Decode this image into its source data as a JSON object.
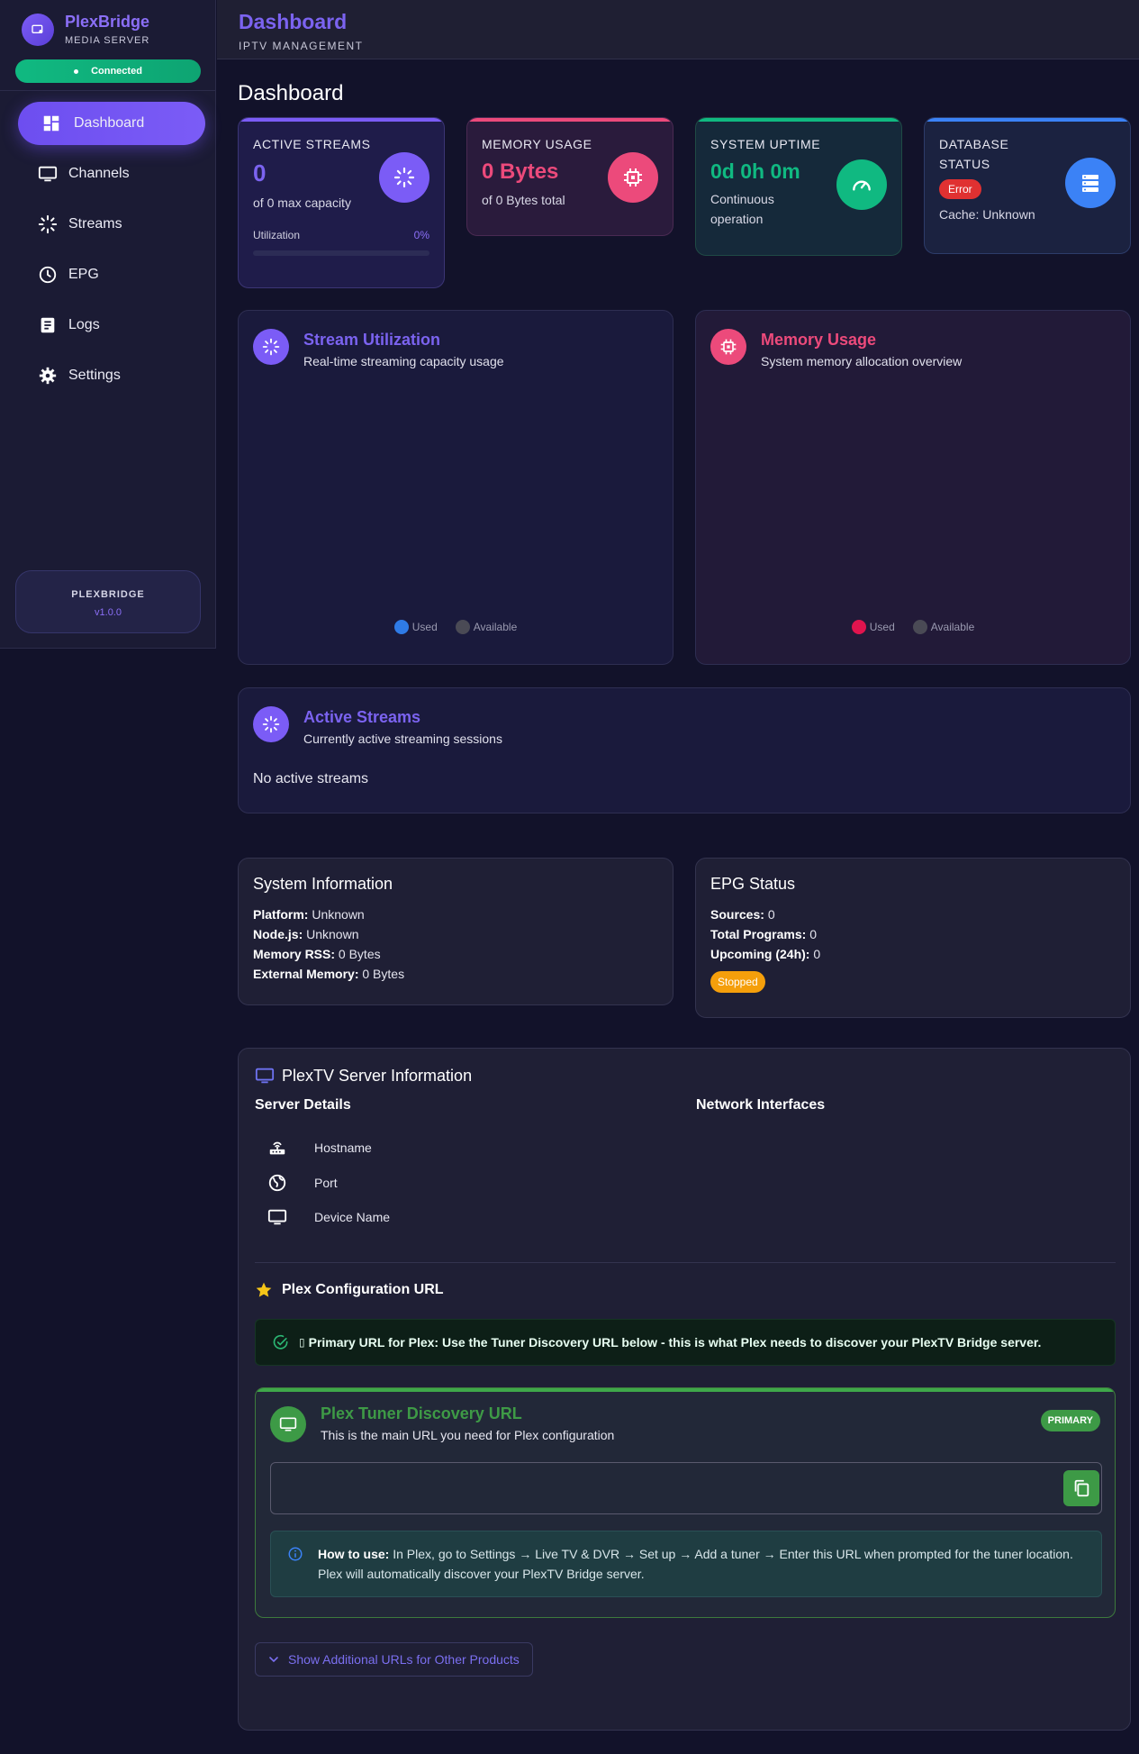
{
  "brand": {
    "name": "PlexBridge",
    "subtitle": "MEDIA SERVER",
    "status": "Connected"
  },
  "sidebar": {
    "items": [
      {
        "label": "Dashboard",
        "icon": "dashboard-icon",
        "active": true
      },
      {
        "label": "Channels",
        "icon": "tv-icon"
      },
      {
        "label": "Streams",
        "icon": "streams-icon"
      },
      {
        "label": "EPG",
        "icon": "clock-icon"
      },
      {
        "label": "Logs",
        "icon": "logs-icon"
      },
      {
        "label": "Settings",
        "icon": "gear-icon"
      }
    ],
    "footer": {
      "name": "PLEXBRIDGE",
      "version": "v1.0.0"
    }
  },
  "header": {
    "title": "Dashboard",
    "subtitle": "IPTV MANAGEMENT"
  },
  "page": {
    "title": "Dashboard"
  },
  "stats": {
    "streams": {
      "label": "ACTIVE STREAMS",
      "value": "0",
      "desc": "of 0 max capacity",
      "util_label": "Utilization",
      "util_pct": "0%",
      "util_fraction": 0
    },
    "memory": {
      "label": "MEMORY USAGE",
      "value": "0 Bytes",
      "desc": "of 0 Bytes total"
    },
    "uptime": {
      "label": "SYSTEM UPTIME",
      "value": "0d 0h 0m",
      "desc": "Continuous operation"
    },
    "database": {
      "label": "DATABASE STATUS",
      "badge": "Error",
      "desc": "Cache: Unknown"
    }
  },
  "colors": {
    "accent": "#7b5cf6",
    "memory": "#ec4a7b",
    "uptime": "#10b981",
    "database": "#3b82f6",
    "error": "#e03131",
    "warning": "#f59f0b",
    "success": "#3d9a46"
  },
  "charts": {
    "stream": {
      "title": "Stream Utilization",
      "subtitle": "Real-time streaming capacity usage",
      "legend_used": "Used",
      "legend_available": "Available"
    },
    "memory": {
      "title": "Memory Usage",
      "subtitle": "System memory allocation overview",
      "legend_used": "Used",
      "legend_available": "Available"
    }
  },
  "active_streams": {
    "title": "Active Streams",
    "subtitle": "Currently active streaming sessions",
    "empty": "No active streams"
  },
  "system_info": {
    "title": "System Information",
    "rows": [
      {
        "key": "Platform:",
        "value": "Unknown"
      },
      {
        "key": "Node.js:",
        "value": "Unknown"
      },
      {
        "key": "Memory RSS:",
        "value": "0 Bytes"
      },
      {
        "key": "External Memory:",
        "value": "0 Bytes"
      }
    ]
  },
  "epg_status": {
    "title": "EPG Status",
    "rows": [
      {
        "key": "Sources:",
        "value": "0"
      },
      {
        "key": "Total Programs:",
        "value": "0"
      },
      {
        "key": "Upcoming (24h):",
        "value": "0"
      }
    ],
    "badge": "Stopped"
  },
  "plextv": {
    "title": "PlexTV Server Information",
    "server_details": "Server Details",
    "network_interfaces": "Network Interfaces",
    "details": [
      {
        "label": "Hostname",
        "icon": "router-icon"
      },
      {
        "label": "Port",
        "icon": "globe-icon"
      },
      {
        "label": "Device Name",
        "icon": "monitor-icon"
      }
    ],
    "config_title": "Plex Configuration URL",
    "alert_icon_glyph": "▯",
    "alert_bold": "Primary URL for Plex:",
    "alert_text": " Use the Tuner Discovery URL below - this is what Plex needs to discover your PlexTV Bridge server.",
    "tuner": {
      "title": "Plex Tuner Discovery URL",
      "subtitle": "This is the main URL you need for Plex configuration",
      "badge": "PRIMARY",
      "url": "",
      "howto_bold": "How to use:",
      "howto_text": " In Plex, go to Settings → Live TV & DVR → Set up → Add a tuner → Enter this URL when prompted for the tuner location. Plex will automatically discover your PlexTV Bridge server."
    },
    "more_button": "Show Additional URLs for Other Products"
  }
}
